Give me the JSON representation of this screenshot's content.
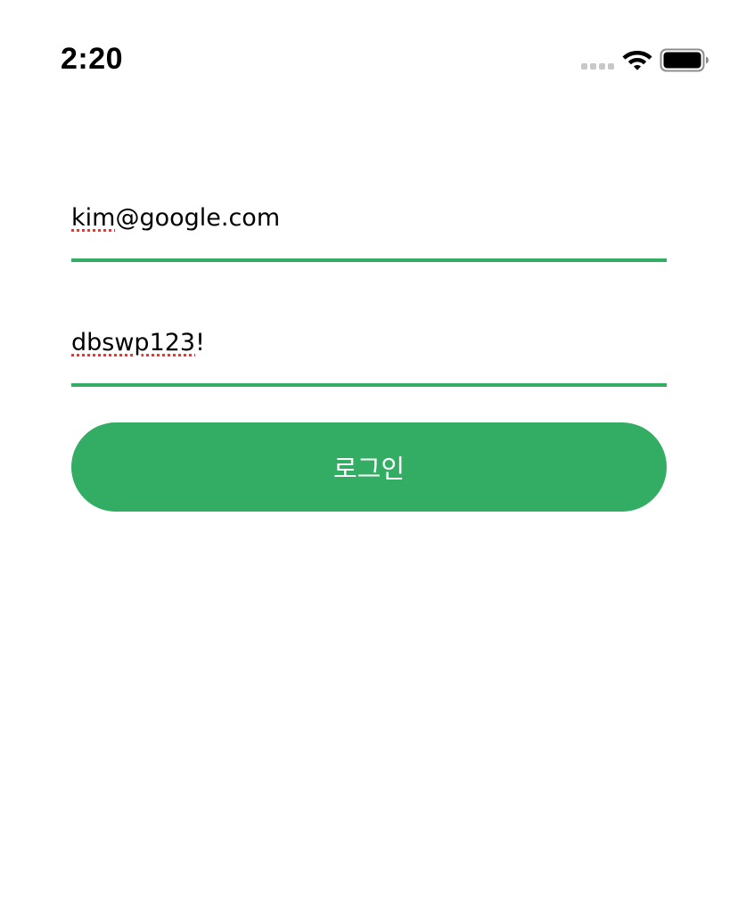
{
  "status_bar": {
    "time": "2:20",
    "icons": [
      "cellular-signal-icon",
      "wifi-icon",
      "battery-icon"
    ]
  },
  "login_form": {
    "email": {
      "value_misspelled_part": "kim",
      "value_rest": "@google.com"
    },
    "password": {
      "value_misspelled_part": "dbswp123",
      "value_rest": "!"
    },
    "submit_label": "로그인"
  },
  "colors": {
    "accent": "#33ad63",
    "spellcheck": "#e53935",
    "background": "#ffffff",
    "text": "#000000"
  }
}
